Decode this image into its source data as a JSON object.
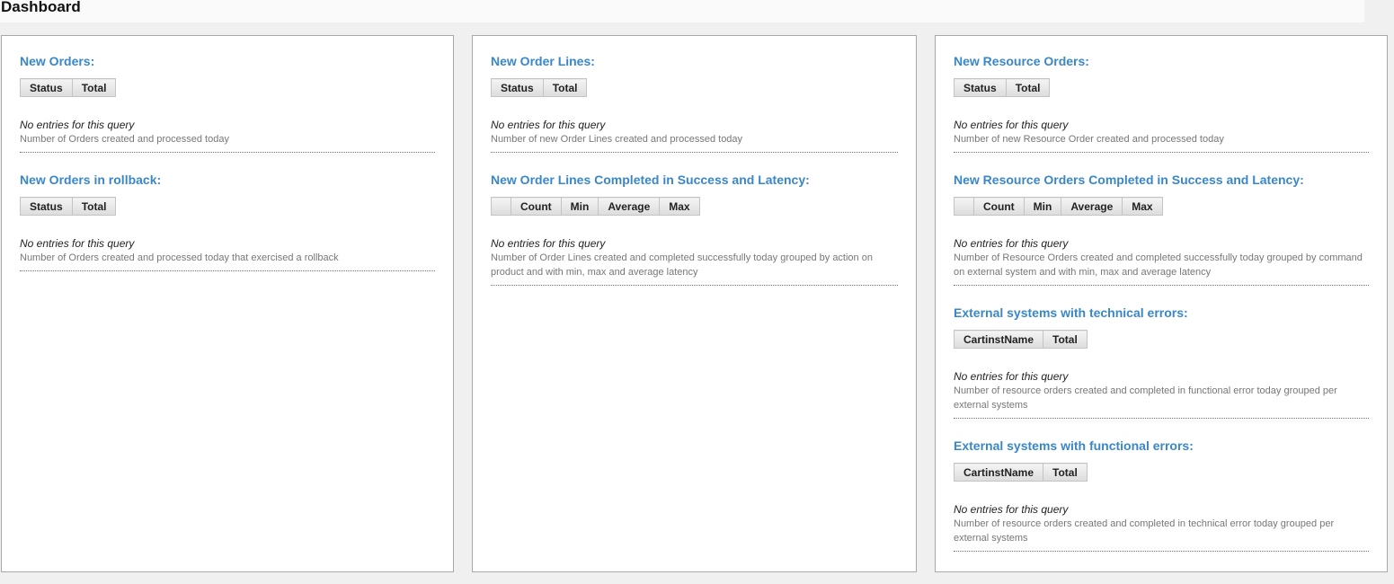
{
  "header": {
    "title": "Dashboard"
  },
  "panels": [
    {
      "sections": [
        {
          "title": "New Orders:",
          "columns": [
            "Status",
            "Total"
          ],
          "empty": "No entries for this query",
          "description": "Number of Orders created and processed today"
        },
        {
          "title": "New Orders in rollback:",
          "columns": [
            "Status",
            "Total"
          ],
          "empty": "No entries for this query",
          "description": "Number of Orders created and processed today that exercised a rollback"
        }
      ]
    },
    {
      "sections": [
        {
          "title": "New Order Lines:",
          "columns": [
            "Status",
            "Total"
          ],
          "empty": "No entries for this query",
          "description": "Number of new Order Lines created and processed today"
        },
        {
          "title": "New Order Lines Completed in Success and Latency:",
          "columns": [
            "",
            "Count",
            "Min",
            "Average",
            "Max"
          ],
          "empty": "No entries for this query",
          "description": "Number of Order Lines created and completed successfully today grouped by action on product and with min, max and average latency"
        }
      ]
    },
    {
      "sections": [
        {
          "title": "New Resource Orders:",
          "columns": [
            "Status",
            "Total"
          ],
          "empty": "No entries for this query",
          "description": "Number of new Resource Order created and processed today"
        },
        {
          "title": "New Resource Orders Completed in Success and Latency:",
          "columns": [
            "",
            "Count",
            "Min",
            "Average",
            "Max"
          ],
          "empty": "No entries for this query",
          "description": "Number of Resource Orders created and completed successfully today grouped by command on external system and with min, max and average latency"
        },
        {
          "title": "External systems with technical errors:",
          "columns": [
            "CartinstName",
            "Total"
          ],
          "empty": "No entries for this query",
          "description": "Number of resource orders created and completed in functional error today grouped per external systems"
        },
        {
          "title": "External systems with functional errors:",
          "columns": [
            "CartinstName",
            "Total"
          ],
          "empty": "No entries for this query",
          "description": "Number of resource orders created and completed in technical error today grouped per external systems"
        }
      ]
    }
  ]
}
